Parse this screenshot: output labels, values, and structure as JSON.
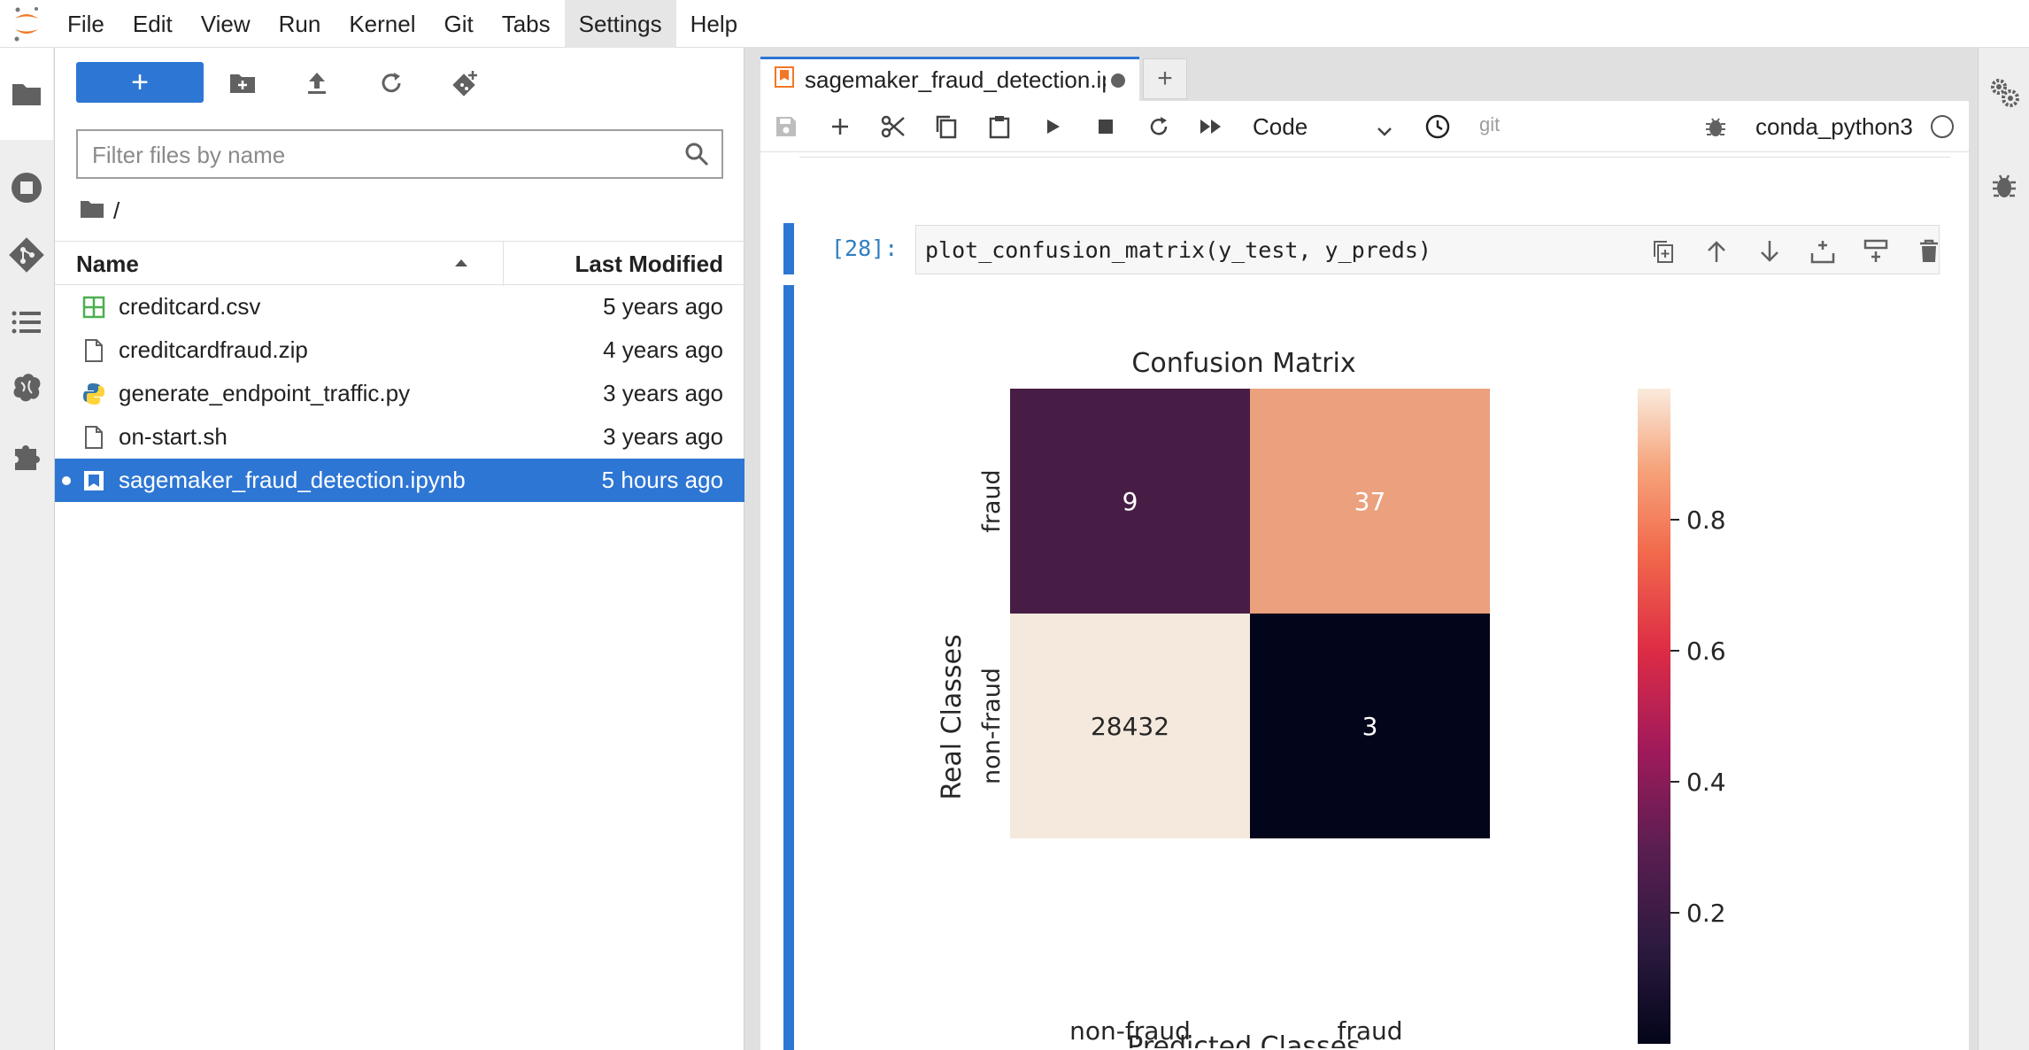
{
  "menu": [
    "File",
    "Edit",
    "View",
    "Run",
    "Kernel",
    "Git",
    "Tabs",
    "Settings",
    "Help"
  ],
  "menu_active": "Settings",
  "filebrowser": {
    "new_label": "+",
    "search_placeholder": "Filter files by name",
    "breadcrumb": "/",
    "col_name": "Name",
    "col_modified": "Last Modified",
    "files": [
      {
        "name": "creditcard.csv",
        "modified": "5 years ago",
        "icon": "spreadsheet-icon"
      },
      {
        "name": "creditcardfraud.zip",
        "modified": "4 years ago",
        "icon": "file-icon"
      },
      {
        "name": "generate_endpoint_traffic.py",
        "modified": "3 years ago",
        "icon": "python-icon"
      },
      {
        "name": "on-start.sh",
        "modified": "3 years ago",
        "icon": "file-icon"
      },
      {
        "name": "sagemaker_fraud_detection.ipynb",
        "modified": "5 hours ago",
        "icon": "notebook-icon",
        "selected": true
      }
    ]
  },
  "tab": {
    "label": "sagemaker_fraud_detection.ipynb",
    "add_label": "+"
  },
  "notebook": {
    "cell_type": "Code",
    "git_label": "git",
    "kernel": "conda_python3",
    "prompt": "[28]:",
    "code": "plot_confusion_matrix(y_test, y_preds)"
  },
  "chart_data": {
    "type": "heatmap",
    "title": "Confusion Matrix",
    "xlabel": "Predicted Classes",
    "ylabel": "Real Classes",
    "x_categories": [
      "non-fraud",
      "fraud"
    ],
    "y_categories": [
      "fraud",
      "non-fraud"
    ],
    "values": [
      [
        9,
        37
      ],
      [
        28432,
        3
      ]
    ],
    "colorbar_ticks": [
      "0.2",
      "0.4",
      "0.6",
      "0.8"
    ],
    "colorbar_range": [
      0,
      1
    ],
    "cell_colors": [
      [
        "#471d46",
        "#eba07e"
      ],
      [
        "#f5e8dd",
        "#03051a"
      ]
    ],
    "annotation_colors": [
      [
        "#ffffff",
        "#ffffff"
      ],
      [
        "#262626",
        "#ffffff"
      ]
    ],
    "colormap": "rocket"
  },
  "colors": {
    "accent": "#2d76d4",
    "prompt": "#307fc1"
  }
}
